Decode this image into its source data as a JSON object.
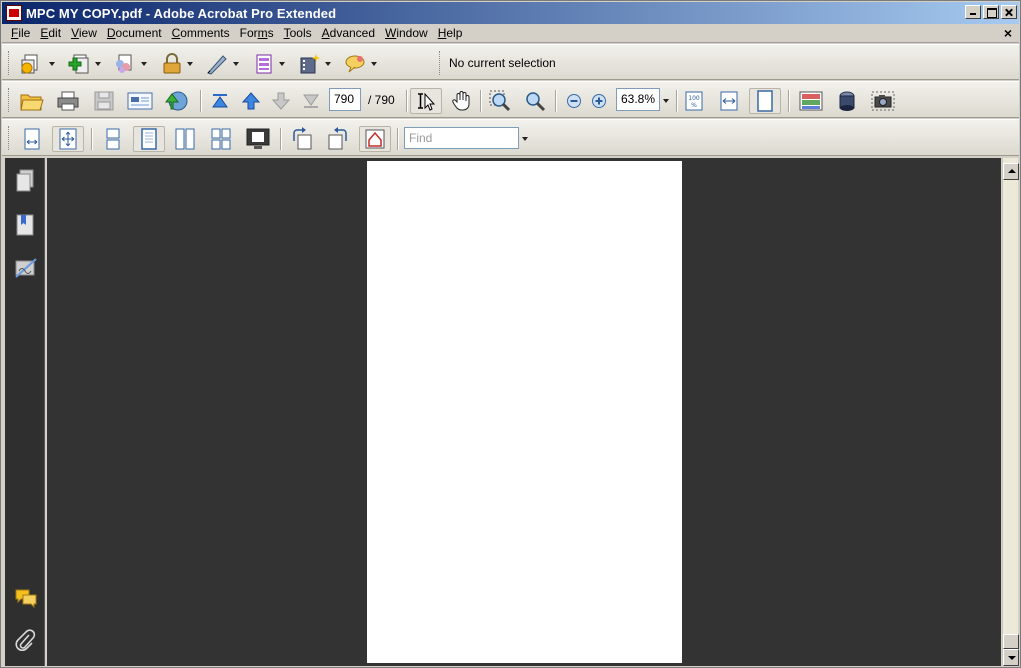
{
  "window": {
    "title": "MPC MY COPY.pdf - Adobe Acrobat Pro Extended"
  },
  "menubar": {
    "items": [
      {
        "label": "File",
        "underline": "F"
      },
      {
        "label": "Edit",
        "underline": "E"
      },
      {
        "label": "View",
        "underline": "V"
      },
      {
        "label": "Document",
        "underline": "D"
      },
      {
        "label": "Comments",
        "underline": "C"
      },
      {
        "label": "Forms",
        "underline": "m"
      },
      {
        "label": "Tools",
        "underline": "T"
      },
      {
        "label": "Advanced",
        "underline": "A"
      },
      {
        "label": "Window",
        "underline": "W"
      },
      {
        "label": "Help",
        "underline": "H"
      }
    ],
    "close_label": "×"
  },
  "toolbar1": {
    "selection_status": "No current selection"
  },
  "toolbar2": {
    "current_page": "790",
    "page_total": "/ 790",
    "zoom": "63.8%"
  },
  "toolbar3": {
    "find_placeholder": "Find"
  },
  "colors": {
    "title_gradient_start": "#0a246a",
    "title_gradient_end": "#a6caf0",
    "doc_background": "#333333",
    "nav_background": "#2f2f2f"
  },
  "icons": {
    "create": "create-pdf-icon",
    "combine": "combine-files-icon",
    "collaborate": "collaborate-icon",
    "secure": "secure-lock-icon",
    "sign": "sign-pen-icon",
    "forms": "forms-icon",
    "multimedia": "multimedia-icon",
    "comment": "comment-icon",
    "open": "open-folder-icon",
    "print": "print-icon",
    "save": "save-disk-icon",
    "email": "email-icon",
    "upload": "upload-globe-icon",
    "first_page": "first-page-icon",
    "prev_page": "previous-page-icon",
    "next_page": "next-page-icon",
    "last_page": "last-page-icon",
    "select": "select-tool-icon",
    "hand": "hand-tool-icon",
    "marquee_zoom": "marquee-zoom-icon",
    "dynamic_zoom": "dynamic-zoom-icon",
    "zoom_out": "zoom-out-icon",
    "zoom_in": "zoom-in-icon"
  }
}
